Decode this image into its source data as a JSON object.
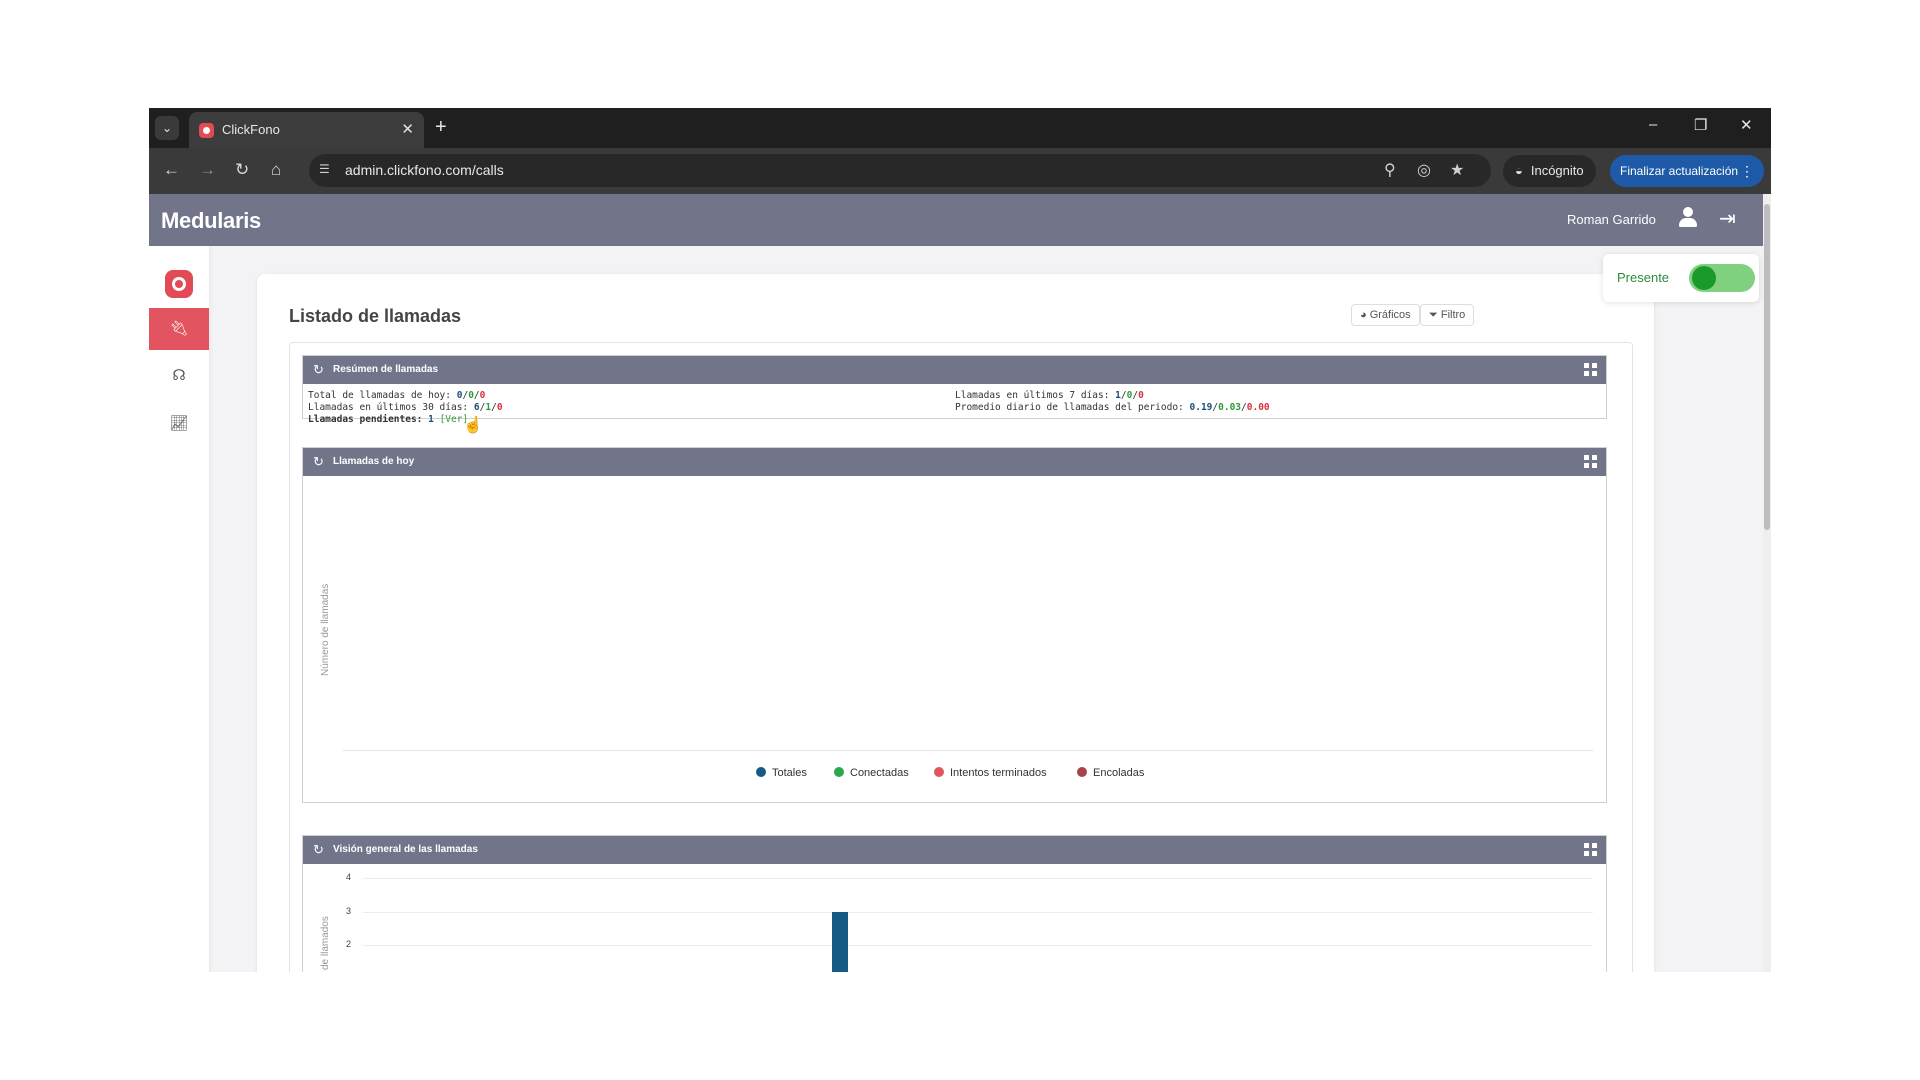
{
  "browser": {
    "tab_title": "ClickFono",
    "url": "admin.clickfono.com/calls",
    "incognito_label": "Incógnito",
    "update_label": "Finalizar actualización",
    "window_controls": [
      "–",
      "❐",
      "✕"
    ]
  },
  "app": {
    "brand": "Medularis",
    "user_name": "Roman Garrido"
  },
  "sidebar": {
    "items": [
      {
        "icon": "plug-icon",
        "active": true
      },
      {
        "icon": "headset-icon",
        "active": false
      },
      {
        "icon": "chart-line-icon",
        "active": false
      }
    ]
  },
  "page": {
    "title": "Listado de llamadas",
    "buttons": {
      "charts": "Gráficos",
      "filter": "Filtro"
    },
    "presence": {
      "label": "Presente",
      "on": true
    }
  },
  "summary": {
    "title": "Resúmen de llamadas",
    "today_label": "Total de llamadas de hoy: ",
    "today_values": [
      "0",
      "0",
      "0"
    ],
    "last30_label": "Llamadas en últimos 30 días: ",
    "last30_values": [
      "6",
      "1",
      "0"
    ],
    "pending_label": "Llamadas pendientes: ",
    "pending_value": "1",
    "pending_link": "[Ver]",
    "last7_label": "Llamadas en últimos 7 días: ",
    "last7_values": [
      "1",
      "0",
      "0"
    ],
    "avg_label": "Promedio diario de llamadas del periodo: ",
    "avg_values": [
      "0.19",
      "0.03",
      "0.00"
    ],
    "sep": "/"
  },
  "today_chart": {
    "title": "Llamadas de hoy",
    "ylabel": "Número de llamadas",
    "legend": [
      {
        "name": "Totales",
        "color": "#165b86"
      },
      {
        "name": "Conectadas",
        "color": "#2aa84a"
      },
      {
        "name": "Intentos terminados",
        "color": "#e0565c"
      },
      {
        "name": "Encoladas",
        "color": "#a8414b"
      }
    ]
  },
  "chart_data": [
    {
      "type": "bar",
      "ylabel": "Número de llamadas",
      "categories": [],
      "series": [
        {
          "name": "Totales",
          "values": []
        },
        {
          "name": "Conectadas",
          "values": []
        },
        {
          "name": "Intentos terminados",
          "values": []
        },
        {
          "name": "Encoladas",
          "values": []
        }
      ]
    },
    {
      "type": "bar",
      "ylabel": "de llamados",
      "y_ticks": [
        "4",
        "3",
        "2"
      ],
      "ylim": [
        0,
        4
      ],
      "series": [
        {
          "name": "Totales",
          "values": [
            3
          ]
        }
      ]
    }
  ],
  "overview_chart": {
    "title": "Visión general de las llamadas",
    "ylabel": "de llamados",
    "y_ticks": [
      "4",
      "3",
      "2"
    ]
  }
}
